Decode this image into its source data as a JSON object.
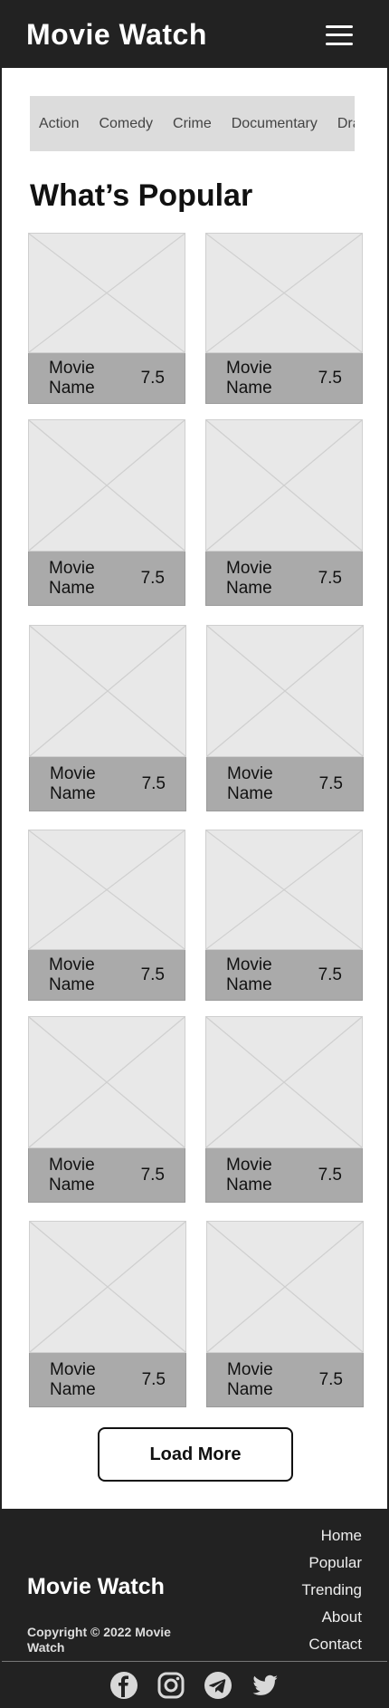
{
  "header": {
    "title": "Movie Watch",
    "menu_icon": "hamburger-menu-icon"
  },
  "genres": [
    "Action",
    "Comedy",
    "Crime",
    "Documentary",
    "Drama"
  ],
  "section": {
    "title": "What’s Popular"
  },
  "movies": [
    {
      "name": "Movie Name",
      "rating": "7.5"
    },
    {
      "name": "Movie Name",
      "rating": "7.5"
    },
    {
      "name": "Movie Name",
      "rating": "7.5"
    },
    {
      "name": "Movie Name",
      "rating": "7.5"
    },
    {
      "name": "Movie Name",
      "rating": "7.5"
    },
    {
      "name": "Movie Name",
      "rating": "7.5"
    },
    {
      "name": "Movie Name",
      "rating": "7.5"
    },
    {
      "name": "Movie Name",
      "rating": "7.5"
    },
    {
      "name": "Movie Name",
      "rating": "7.5"
    },
    {
      "name": "Movie Name",
      "rating": "7.5"
    },
    {
      "name": "Movie Name",
      "rating": "7.5"
    },
    {
      "name": "Movie Name",
      "rating": "7.5"
    }
  ],
  "load_more_label": "Load More",
  "footer": {
    "brand": "Movie Watch",
    "copyright": "Copyright © 2022 Movie Watch",
    "links": [
      "Home",
      "Popular",
      "Trending",
      "About",
      "Contact"
    ],
    "social": [
      "facebook-icon",
      "instagram-icon",
      "telegram-icon",
      "twitter-icon"
    ]
  },
  "colors": {
    "header_bg": "#222222",
    "genre_bar_bg": "#dcdcdc",
    "poster_bg": "#e8e8e8",
    "caption_bg": "#aaaaaa",
    "footer_bg": "#222222"
  }
}
